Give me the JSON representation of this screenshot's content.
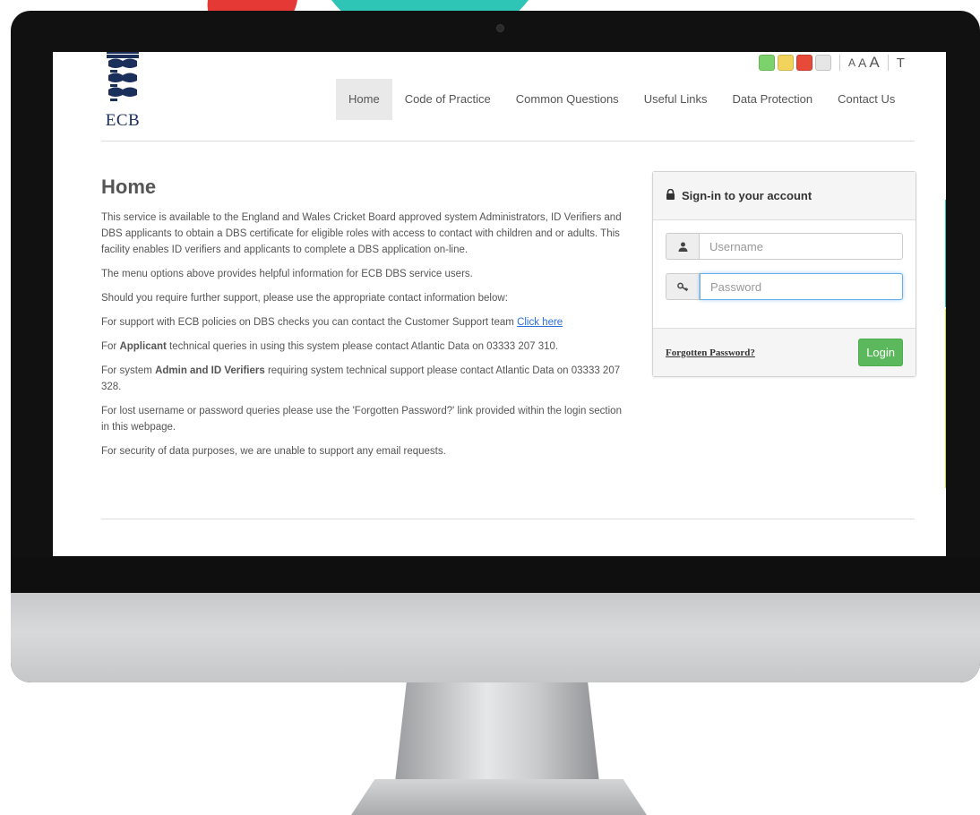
{
  "header": {
    "logo_text": "ECB",
    "contrast_swatches": [
      "#7dd36b",
      "#f2d45c",
      "#e84a3a",
      "#e6e6e6"
    ],
    "text_size_labels": [
      "A",
      "A",
      "A"
    ],
    "text_mode_label": "T"
  },
  "nav": {
    "items": [
      {
        "label": "Home",
        "active": true
      },
      {
        "label": "Code of Practice"
      },
      {
        "label": "Common Questions"
      },
      {
        "label": "Useful Links"
      },
      {
        "label": "Data Protection"
      },
      {
        "label": "Contact Us"
      }
    ]
  },
  "main": {
    "title": "Home",
    "p1": "This service is available to the England and Wales Cricket Board approved system Administrators, ID Verifiers and DBS applicants to obtain a DBS certificate for eligible roles with access to contact with children and or adults. This facility enables ID verifiers and applicants to complete a DBS application on-line.",
    "p2": "The menu options above provides helpful information for ECB DBS service users.",
    "p3": "Should you require further support, please use the appropriate contact information below:",
    "p4_text": "For support with ECB policies on DBS checks you can contact the Customer Support team ",
    "p4_link": "Click here",
    "p5_pre": "For ",
    "p5_bold": "Applicant",
    "p5_post": " technical queries in using this system please contact Atlantic Data on 03333 207 310.",
    "p6_pre": "For system ",
    "p6_bold": "Admin and ID Verifiers",
    "p6_post": " requiring system technical support please contact Atlantic Data on 03333 207 328.",
    "p7": "For lost username or password queries please use the 'Forgotten Password?' link provided within the login section in this webpage.",
    "p8": "For security of data purposes, we are unable to support any email requests."
  },
  "login": {
    "heading": "Sign-in to your account",
    "username_placeholder": "Username",
    "password_placeholder": "Password",
    "forgot_label": "Forgotten Password?",
    "login_label": "Login"
  }
}
